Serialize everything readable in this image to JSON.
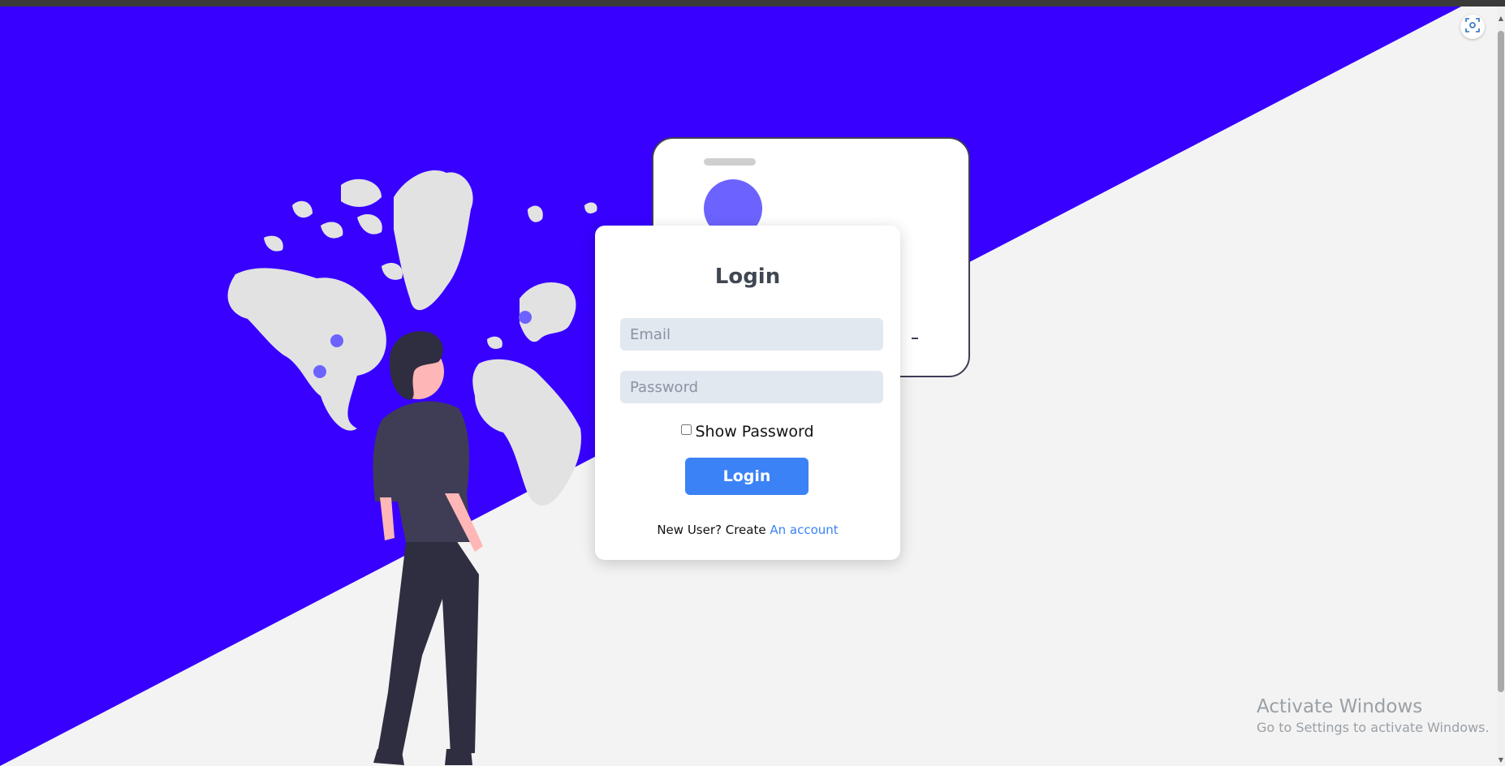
{
  "login": {
    "title": "Login",
    "email_placeholder": "Email",
    "password_placeholder": "Password",
    "show_password_label": "Show Password",
    "button_label": "Login",
    "new_user_text": "New User? Create",
    "create_link_text": "An account"
  },
  "watermark": {
    "title": "Activate Windows",
    "subtitle": "Go to Settings to activate Windows."
  },
  "colors": {
    "background_blue": "#3700ff",
    "background_gray": "#f3f3f3",
    "accent_purple": "#6c63ff",
    "button_blue": "#3b82f6",
    "map_gray": "#e2e2e2",
    "figure_dark": "#2f2e41"
  },
  "icons": {
    "capture": "screen-capture-icon",
    "scroll_up": "scroll-up-arrow-icon",
    "scroll_down": "scroll-down-arrow-icon"
  }
}
